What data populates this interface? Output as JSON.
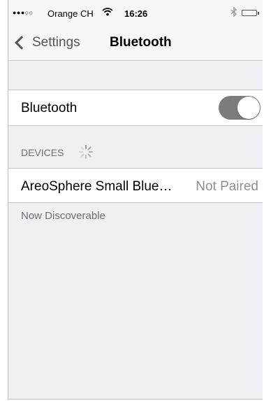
{
  "status_bar": {
    "signal": "●●●○○",
    "carrier": "Orange CH",
    "wifi_icon": "wifi-icon",
    "time": "16:26",
    "bluetooth_icon": "bluetooth-icon",
    "battery_icon": "battery-icon"
  },
  "nav": {
    "back_label": "Settings",
    "title": "Bluetooth"
  },
  "bluetooth_row": {
    "label": "Bluetooth",
    "toggle_on": true
  },
  "devices_section": {
    "header": "DEVICES",
    "spinner_icon": "activity-spinner-icon"
  },
  "devices": [
    {
      "name": "AreoSphere Small Blue…",
      "status": "Not Paired"
    }
  ],
  "footer_text": "Now Discoverable",
  "colors": {
    "toggle_track": "#7c7c7c",
    "background": "#efeff4",
    "secondary_text": "#8e8e93"
  }
}
